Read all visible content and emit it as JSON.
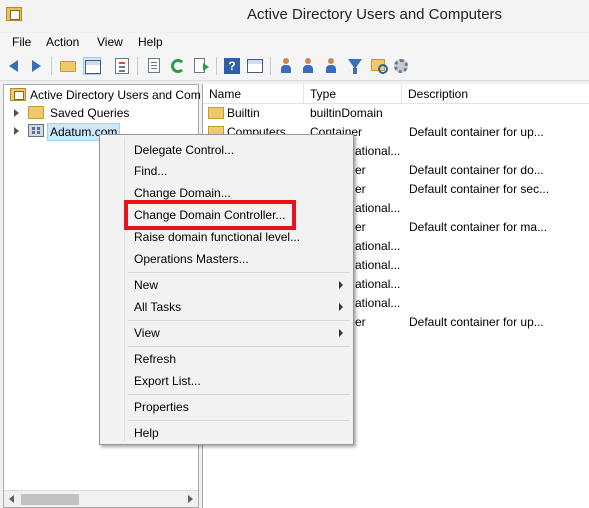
{
  "window": {
    "title": "Active Directory Users and Computers"
  },
  "menubar": {
    "items": [
      "File",
      "Action",
      "View",
      "Help"
    ]
  },
  "toolbar": {
    "buttons": [
      "back-icon",
      "forward-icon",
      "up-folder-icon",
      "show-tree-icon",
      "properties-icon",
      "export-icon",
      "refresh-icon",
      "export-list-icon",
      "help-icon",
      "grid-icon",
      "new-user-icon",
      "new-group-icon",
      "new-ou-icon",
      "filter-icon",
      "find-icon",
      "settings-icon"
    ]
  },
  "tree": {
    "root": "Active Directory Users and Com",
    "items": [
      "Saved Queries",
      "Adatum.com"
    ]
  },
  "list": {
    "columns": [
      "Name",
      "Type",
      "Description"
    ],
    "rows": [
      {
        "name": "Builtin",
        "type": "builtinDomain",
        "description": ""
      },
      {
        "name": "Computers",
        "type": "Container",
        "description": "Default container for up..."
      },
      {
        "name": "",
        "type": "ational...",
        "description": ""
      },
      {
        "name": "",
        "type": "er",
        "description": "Default container for do..."
      },
      {
        "name": "",
        "type": "er",
        "description": "Default container for sec..."
      },
      {
        "name": "",
        "type": "ational...",
        "description": ""
      },
      {
        "name": "",
        "type": "er",
        "description": "Default container for ma..."
      },
      {
        "name": "",
        "type": "ational...",
        "description": ""
      },
      {
        "name": "",
        "type": "ational...",
        "description": ""
      },
      {
        "name": "",
        "type": "ational...",
        "description": ""
      },
      {
        "name": "",
        "type": "ational...",
        "description": ""
      },
      {
        "name": "",
        "type": "er",
        "description": "Default container for up..."
      }
    ]
  },
  "context_menu": {
    "groups": [
      [
        "Delegate Control...",
        "Find...",
        "Change Domain...",
        "Change Domain Controller...",
        "Raise domain functional level...",
        "Operations Masters..."
      ],
      [
        "New",
        "All Tasks"
      ],
      [
        "View"
      ],
      [
        "Refresh",
        "Export List..."
      ],
      [
        "Properties"
      ],
      [
        "Help"
      ]
    ],
    "highlighted": "Change Domain Controller...",
    "highlight_color": "#e4141b"
  }
}
